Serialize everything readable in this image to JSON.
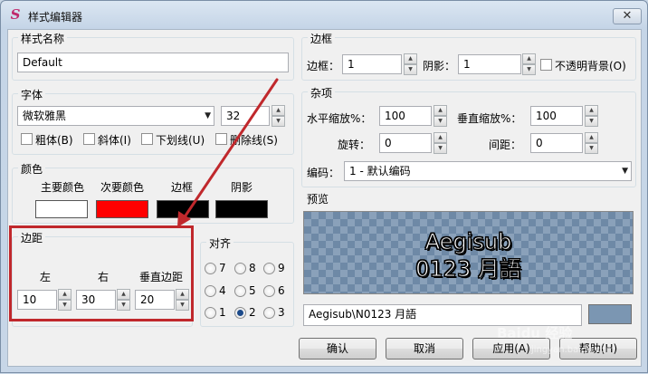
{
  "window": {
    "title": "样式编辑器",
    "app_icon_glyph": "S",
    "close_glyph": "✕"
  },
  "style_name": {
    "label": "样式名称",
    "value": "Default"
  },
  "font": {
    "label": "字体",
    "family": "微软雅黑",
    "size": "32",
    "bold": "粗体(B)",
    "italic": "斜体(I)",
    "underline": "下划线(U)",
    "strikeout": "删除线(S)"
  },
  "colors": {
    "label": "颜色",
    "primary_label": "主要颜色",
    "secondary_label": "次要颜色",
    "outline_label": "边框",
    "shadow_label": "阴影",
    "primary_hex": "#ffffff",
    "secondary_hex": "#ff0000",
    "outline_hex": "#000000",
    "shadow_hex": "#000000"
  },
  "margins": {
    "label": "边距",
    "left_label": "左",
    "right_label": "右",
    "vertical_label": "垂直边距",
    "left": "10",
    "right": "30",
    "vertical": "20"
  },
  "alignment": {
    "label": "对齐",
    "options": [
      "7",
      "8",
      "9",
      "4",
      "5",
      "6",
      "1",
      "2",
      "3"
    ],
    "selected": "2"
  },
  "border": {
    "label": "边框",
    "outline_label": "边框：",
    "outline_value": "1",
    "shadow_label": "阴影：",
    "shadow_value": "1",
    "opaque_label": "不透明背景(O)"
  },
  "misc": {
    "label": "杂项",
    "scale_x_label": "水平缩放%：",
    "scale_x": "100",
    "scale_y_label": "垂直缩放%：",
    "scale_y": "100",
    "rotation_label": "旋转：",
    "rotation": "0",
    "spacing_label": "间距：",
    "spacing": "0",
    "encoding_label": "编码：",
    "encoding": "1 - 默认编码"
  },
  "preview": {
    "label": "预览",
    "line1": "Aegisub",
    "line2": "0123 月語",
    "text": "Aegisub\\N0123 月語",
    "bg_color": "#7b96b2"
  },
  "buttons": {
    "ok": "确认",
    "cancel": "取消",
    "apply": "应用(A)",
    "help": "帮助(H)"
  },
  "icons": {
    "spin_up": "▲",
    "spin_down": "▼",
    "combo_arrow": "▼"
  },
  "accent_colors": {
    "annotation": "#c0282c"
  },
  "watermark": {
    "main": "Baidu 经验",
    "sub": "jingyan.baidu.com"
  }
}
